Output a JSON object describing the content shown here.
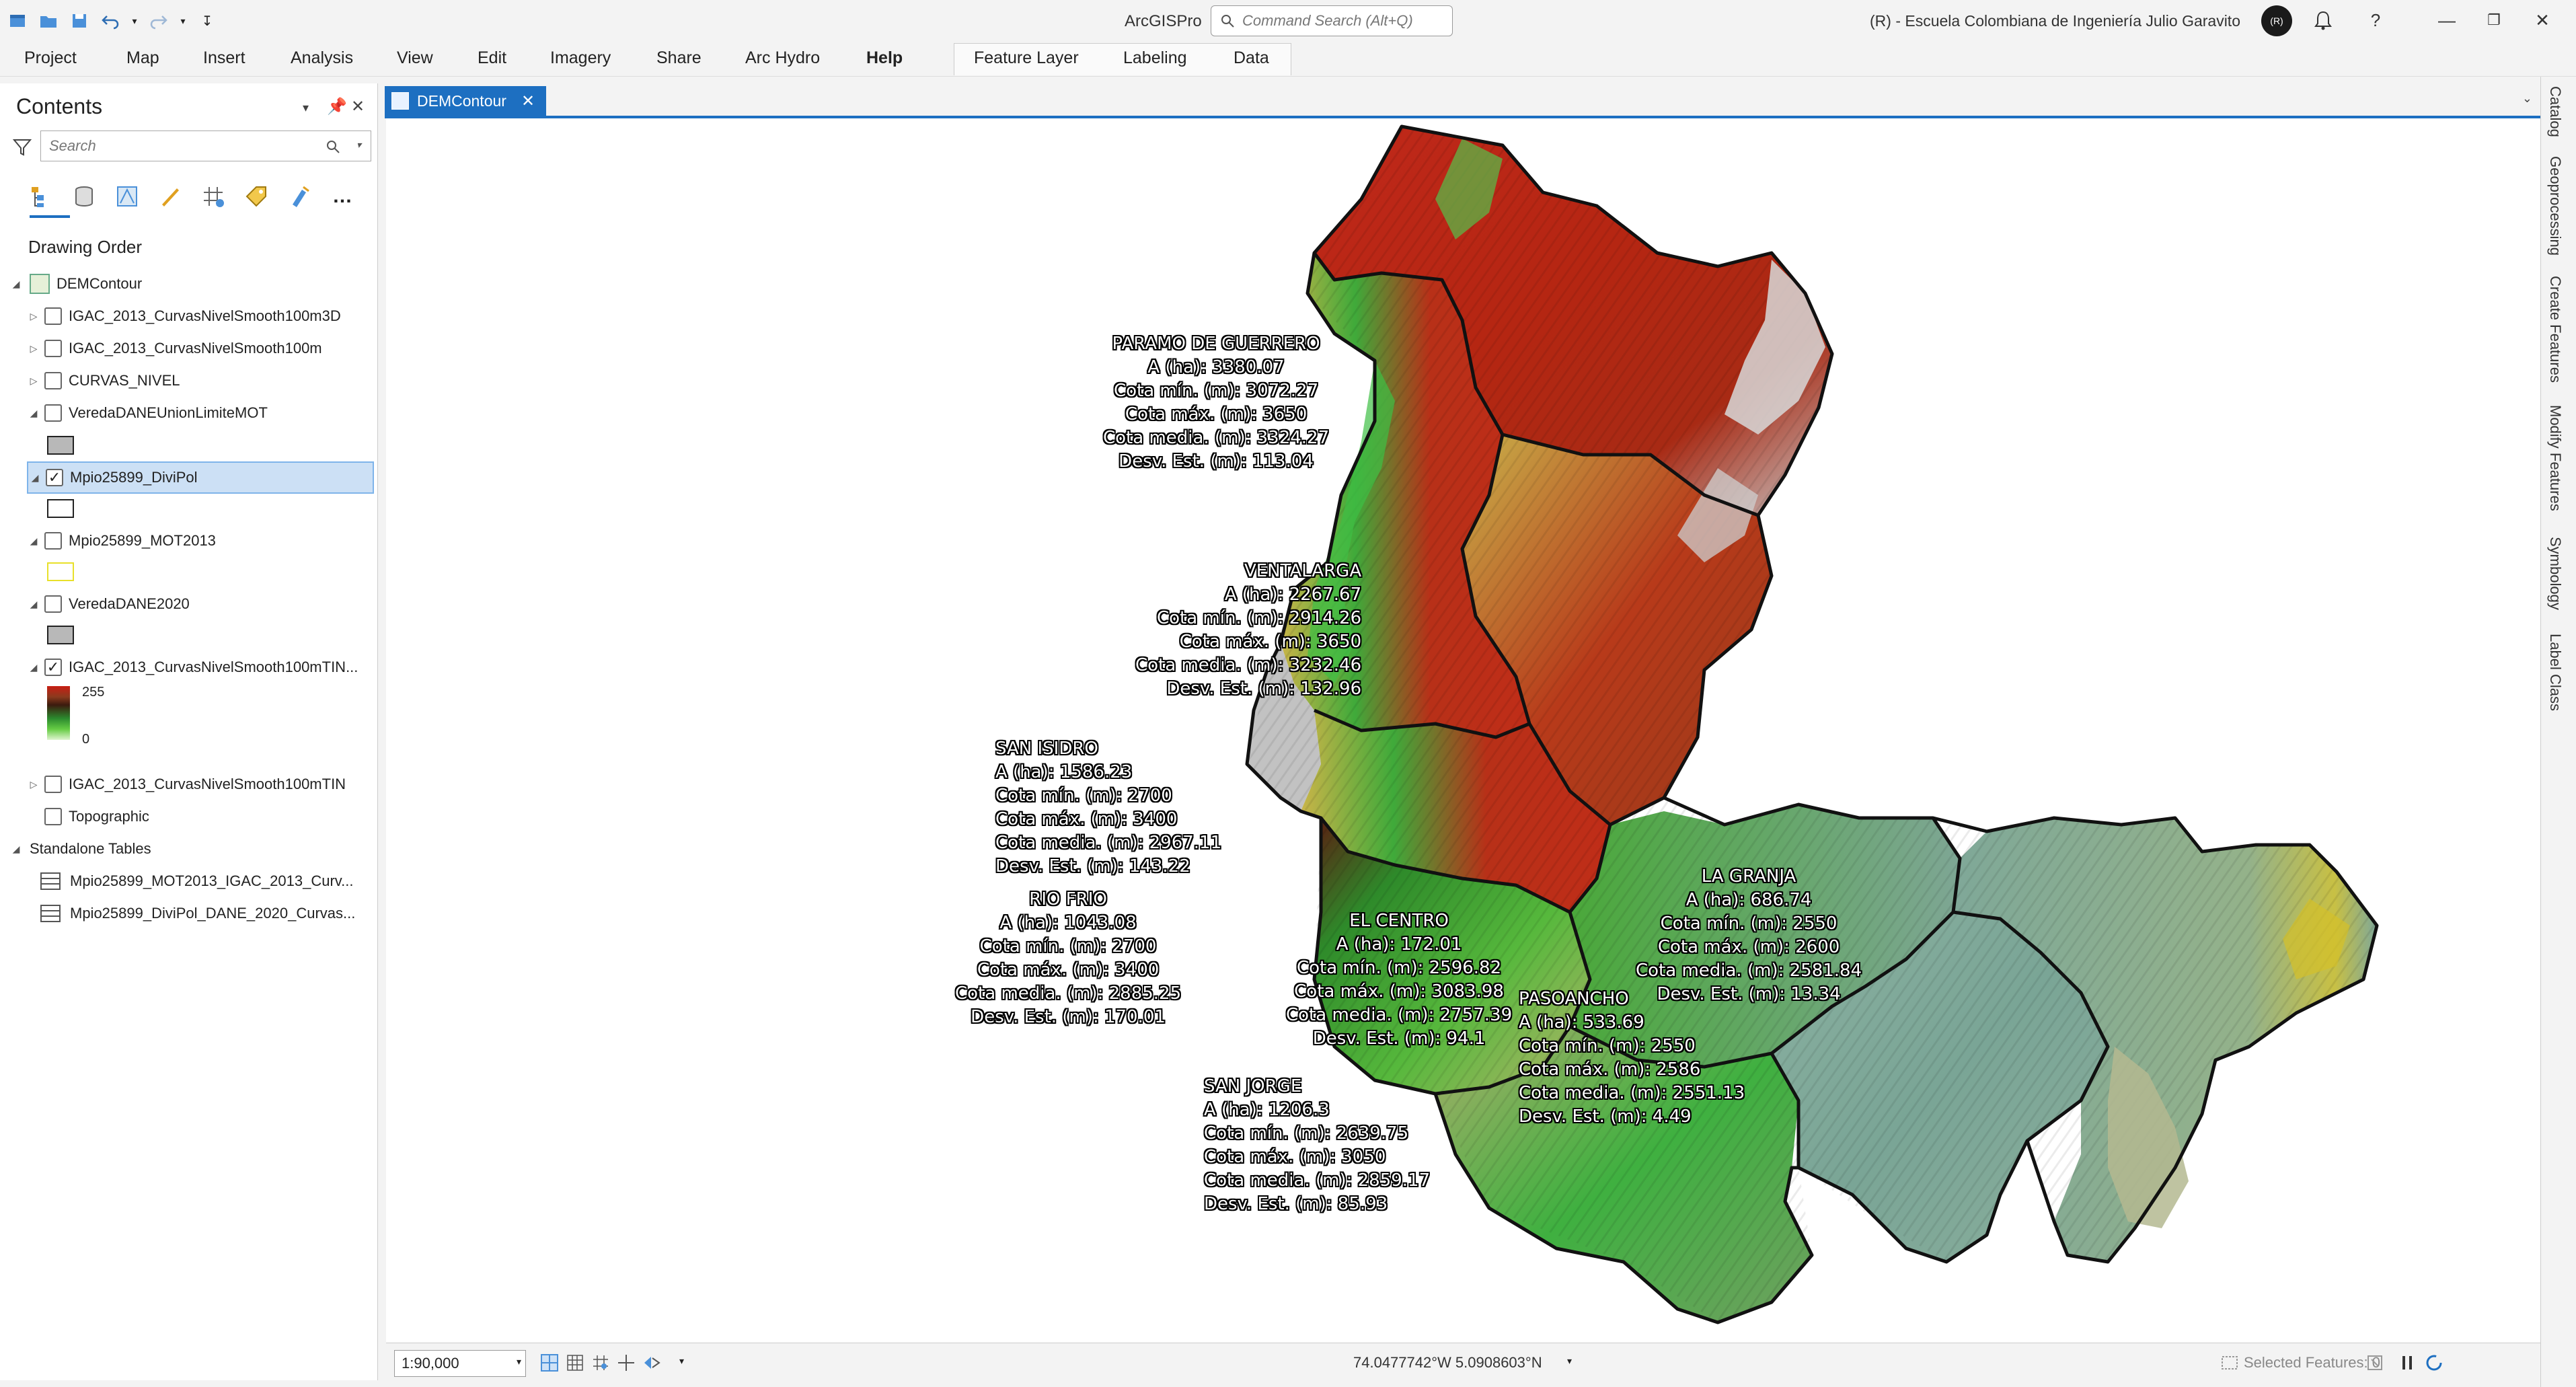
{
  "titlebar": {
    "app_title": "ArcGISPro",
    "command_search_placeholder": "Command Search (Alt+Q)",
    "organization": "(R) - Escuela Colombiana de Ingeniería Julio Garavito",
    "avatar_initials": "(R)",
    "qat_icons": [
      "new-project-icon",
      "open-project-icon",
      "save-project-icon",
      "undo-icon",
      "redo-icon",
      "customize-qat-icon"
    ],
    "window_controls": [
      "minimize-icon",
      "restore-icon",
      "close-icon"
    ]
  },
  "ribbon": {
    "tabs": [
      "Project",
      "Map",
      "Insert",
      "Analysis",
      "View",
      "Edit",
      "Imagery",
      "Share",
      "Arc Hydro",
      "Help"
    ],
    "active_tab": "Help",
    "context_tabs": [
      "Feature Layer",
      "Labeling",
      "Data"
    ]
  },
  "contents": {
    "title": "Contents",
    "search_placeholder": "Search",
    "section_title": "Drawing Order",
    "map_name": "DEMContour",
    "layers": [
      {
        "name": "IGAC_2013_CurvasNivelSmooth100m3D",
        "checked": false
      },
      {
        "name": "IGAC_2013_CurvasNivelSmooth100m",
        "checked": false
      },
      {
        "name": "CURVAS_NIVEL",
        "checked": false
      },
      {
        "name": "VeredaDANEUnionLimiteMOT",
        "checked": false
      },
      {
        "name": "Mpio25899_DiviPol",
        "checked": true
      },
      {
        "name": "Mpio25899_MOT2013",
        "checked": false
      },
      {
        "name": "VeredaDANE2020",
        "checked": false
      },
      {
        "name": "IGAC_2013_CurvasNivelSmooth100mTIN...",
        "checked": true
      },
      {
        "name": "IGAC_2013_CurvasNivelSmooth100mTIN",
        "checked": false
      },
      {
        "name": "Topographic",
        "checked": false
      }
    ],
    "legend_high": "255",
    "legend_low": "0",
    "standalone_title": "Standalone Tables",
    "tables": [
      "Mpio25899_MOT2013_IGAC_2013_Curv...",
      "Mpio25899_DiviPol_DANE_2020_Curvas..."
    ]
  },
  "map": {
    "tab_title": "DEMContour",
    "labels": [
      {
        "name": "PARAMO DE GUERRERO",
        "area": "A (ha): 3380.07",
        "min": "Cota mín. (m): 3072.27",
        "max": "Cota máx. (m): 3650",
        "mean": "Cota media. (m): 3324.27",
        "std": "Desv. Est. (m): 113.04"
      },
      {
        "name": "VENTALARGA",
        "area": "A (ha): 2267.67",
        "min": "Cota mín. (m): 2914.26",
        "max": "Cota máx. (m): 3650",
        "mean": "Cota media. (m): 3232.46",
        "std": "Desv. Est. (m): 132.96"
      },
      {
        "name": "SAN ISIDRO",
        "area": "A (ha): 1586.23",
        "min": "Cota mín. (m): 2700",
        "max": "Cota máx. (m): 3400",
        "mean": "Cota media. (m): 2967.11",
        "std": "Desv. Est. (m): 143.22"
      },
      {
        "name": "RIO FRIO",
        "area": "A (ha): 1043.08",
        "min": "Cota mín. (m): 2700",
        "max": "Cota máx. (m): 3400",
        "mean": "Cota media. (m): 2885.25",
        "std": "Desv. Est. (m): 170.01"
      },
      {
        "name": "EL CENTRO",
        "area": "A (ha): 172.01",
        "min": "Cota mín. (m): 2596.82",
        "max": "Cota máx. (m): 3083.98",
        "mean": "Cota media. (m): 2757.39",
        "std": "Desv. Est. (m): 94.1"
      },
      {
        "name": "LA GRANJA",
        "area": "A (ha): 686.74",
        "min": "Cota mín. (m): 2550",
        "max": "Cota máx. (m): 2600",
        "mean": "Cota media. (m): 2581.84",
        "std": "Desv. Est. (m): 13.34"
      },
      {
        "name": "PASOANCHO",
        "area": "A (ha): 533.69",
        "min": "Cota mín. (m): 2550",
        "max": "Cota máx. (m): 2586",
        "mean": "Cota media. (m): 2551.13",
        "std": "Desv. Est. (m): 4.49"
      },
      {
        "name": "SAN JORGE",
        "area": "A (ha): 1206.3",
        "min": "Cota mín. (m): 2639.75",
        "max": "Cota máx. (m): 3050",
        "mean": "Cota media. (m): 2859.17",
        "std": "Desv. Est. (m): 85.93"
      }
    ]
  },
  "statusbar": {
    "scale": "1:90,000",
    "coordinates": "74.0477742°W 5.0908603°N",
    "selected_features": "Selected Features: 0"
  },
  "right_dock": {
    "tabs": [
      "Catalog",
      "Geoprocessing",
      "Create Features",
      "Modify Features",
      "Symbology",
      "Label Class"
    ]
  },
  "colors": {
    "accent": "#1d6fc1",
    "selection": "#cce0f5",
    "highland_red": "#b8230f",
    "lowland_teal": "#7ea89a",
    "midland_green": "#3fa83a"
  }
}
